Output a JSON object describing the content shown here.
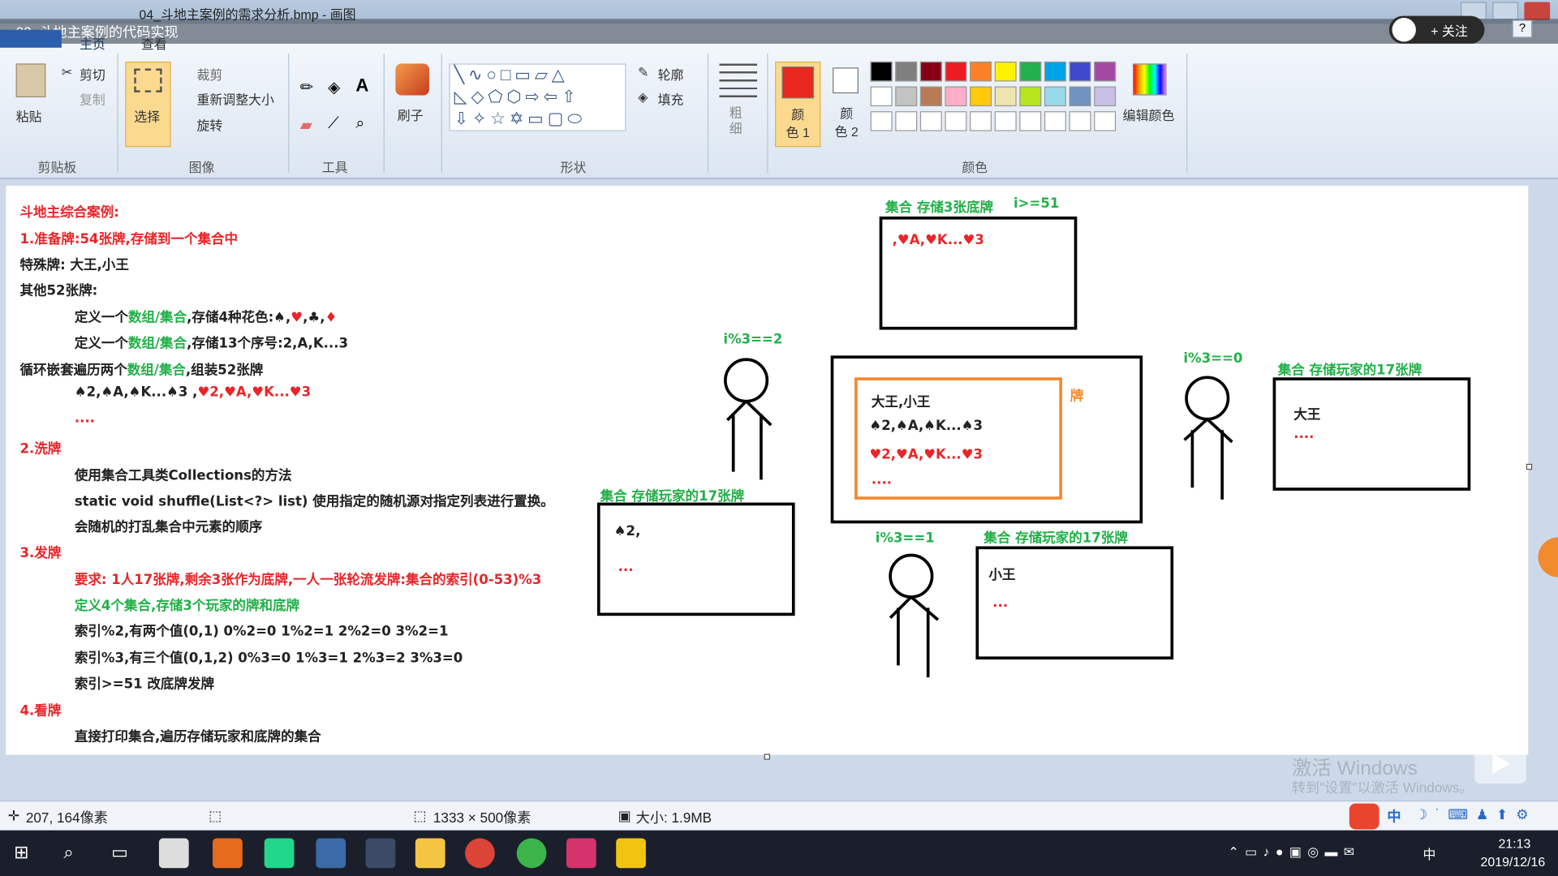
{
  "window": {
    "title": "04_斗地主案例的需求分析.bmp - 画图",
    "overlay_title": "02_斗地主案例的代码实现",
    "follow_label": "+ 关注"
  },
  "ribbon": {
    "tabs": [
      "主页",
      "查看"
    ],
    "clipboard": {
      "paste": "粘贴",
      "cut": "剪切",
      "copy": "复制",
      "label": "剪贴板"
    },
    "image": {
      "select": "选择",
      "crop": "裁剪",
      "resize": "重新调整大小",
      "rotate": "旋转",
      "label": "图像"
    },
    "tools": {
      "label": "工具"
    },
    "brush": {
      "label": "刷子"
    },
    "shapes": {
      "outline": "轮廓",
      "fill": "填充",
      "label": "形状"
    },
    "size": {
      "label": "粗细"
    },
    "colors": {
      "color1": "颜色 1",
      "color2": "颜色 2",
      "edit": "编辑颜色",
      "label": "颜色",
      "color1_value": "#e8271f",
      "palette_row1": [
        "#000000",
        "#7f7f7f",
        "#880015",
        "#ed1c24",
        "#ff7f27",
        "#fff200",
        "#22b14c",
        "#00a2e8",
        "#3f48cc",
        "#a349a4"
      ],
      "palette_row2": [
        "#ffffff",
        "#c3c3c3",
        "#b97a57",
        "#ffaec9",
        "#ffc90e",
        "#efe4b0",
        "#b5e61d",
        "#99d9ea",
        "#7092be",
        "#c8bfe7"
      ]
    }
  },
  "notes": {
    "l1": "斗地主综合案例:",
    "l2": "1.准备牌:54张牌,存储到一个集合中",
    "l3": "特殊牌: 大王,小王",
    "l4": "其他52张牌:",
    "l5a": "定义一个",
    "l5b": "数组/集合",
    "l5c": ",存储4种花色:♠,",
    "l5d": "♥",
    "l5e": ",♣,",
    "l5f": "♦",
    "l6a": "定义一个",
    "l6b": "数组/集合",
    "l6c": ",存储13个序号:2,A,K...3",
    "l7a": "循环嵌套遍历两个",
    "l7b": "数组/集合",
    "l7c": ",组装52张牌",
    "l8a": "♠2,♠A,♠K...♠3",
    "l8b": " ,",
    "l8c": "♥2,♥A,♥K...♥3",
    "l9": "....",
    "l10": "2.洗牌",
    "l11": "使用集合工具类Collections的方法",
    "l12": "static void shuffle(List<?> list) 使用指定的随机源对指定列表进行置换。",
    "l13": "会随机的打乱集合中元素的顺序",
    "l14": "3.发牌",
    "l15": "要求: 1人17张牌,剩余3张作为底牌,一人一张轮流发牌:集合的索引(0-53)%3",
    "l16": "定义4个集合,存储3个玩家的牌和底牌",
    "l17": "索引%2,有两个值(0,1) 0%2=0 1%2=1 2%2=0 3%2=1",
    "l18": "索引%3,有三个值(0,1,2) 0%3=0 1%3=1 2%3=2 3%3=0",
    "l19": "索引>=51 改底牌发牌",
    "l20": "4.看牌",
    "l21": "直接打印集合,遍历存储玩家和底牌的集合"
  },
  "diagram": {
    "dipai_title": "集合 存储3张底牌",
    "dipai_cond": "i>=51",
    "dipai_content": ",♥A,♥K...♥3",
    "p2_cond": "i%3==2",
    "p2_title": "集合 存储玩家的17张牌",
    "p2_c1": "♠2,",
    "p2_c2": "...",
    "center_label": "牌",
    "center_l1": "大王,小王",
    "center_l2": "♠2,♠A,♠K...♠3",
    "center_l3": "♥2,♥A,♥K...♥3",
    "center_l4": "....",
    "p0_cond": "i%3==0",
    "p0_title": "集合 存储玩家的17张牌",
    "p0_c1": "大王",
    "p0_c2": "....",
    "p1_cond": "i%3==1",
    "p1_title": "集合 存储玩家的17张牌",
    "p1_c1": "小王",
    "p1_c2": "..."
  },
  "watermark": {
    "l1": "激活 Windows",
    "l2": "转到\"设置\"以激活 Windows。"
  },
  "status": {
    "cursor": "207, 164像素",
    "dimensions": "1333 × 500像素",
    "size": "大小: 1.9MB"
  },
  "taskbar": {
    "time": "21:13",
    "date": "2019/12/16",
    "ime": "中"
  }
}
